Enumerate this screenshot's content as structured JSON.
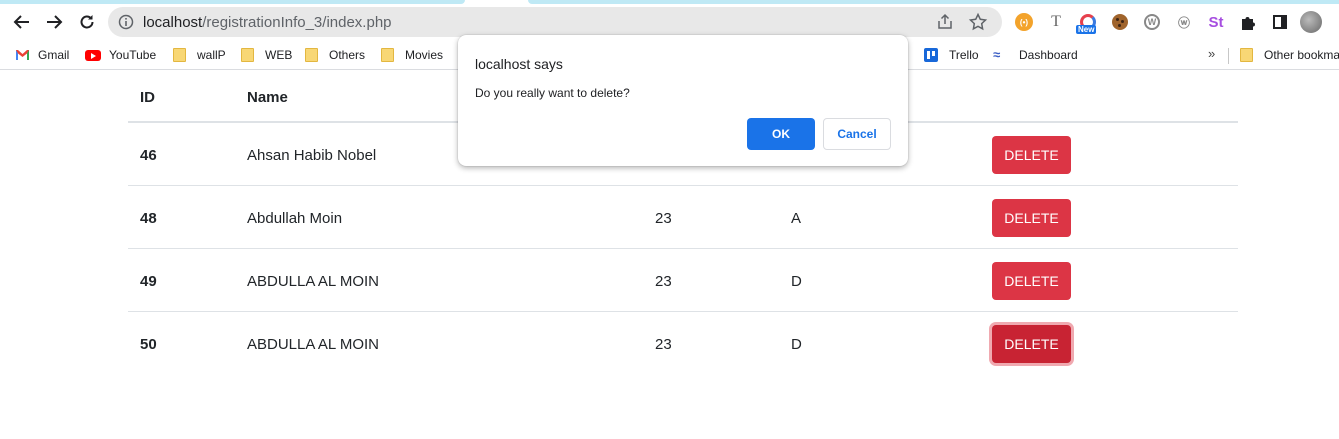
{
  "browser": {
    "url_host": "localhost",
    "url_path": "/registrationInfo_3/index.php",
    "new_badge": "New"
  },
  "bookmarks": [
    {
      "label": "Gmail",
      "icon": "gmail-icon"
    },
    {
      "label": "YouTube",
      "icon": "youtube-icon"
    },
    {
      "label": "wallP",
      "icon": "folder-icon"
    },
    {
      "label": "WEB",
      "icon": "folder-icon"
    },
    {
      "label": "Others",
      "icon": "folder-icon"
    },
    {
      "label": "Movies",
      "icon": "folder-icon"
    },
    {
      "label": "Trello",
      "icon": "trello-icon"
    },
    {
      "label": "Dashboard",
      "icon": "dashboard-icon"
    },
    {
      "label": "Other bookma",
      "icon": "folder-icon"
    }
  ],
  "bookmarks_more": "»",
  "table": {
    "headers": {
      "id": "ID",
      "name": "Name"
    },
    "rows": [
      {
        "id": "46",
        "name": "Ahsan Habib Nobel",
        "age": "",
        "grade": "",
        "action": "DELETE"
      },
      {
        "id": "48",
        "name": "Abdullah Moin",
        "age": "23",
        "grade": "A",
        "action": "DELETE"
      },
      {
        "id": "49",
        "name": "ABDULLA AL MOIN",
        "age": "23",
        "grade": "D",
        "action": "DELETE"
      },
      {
        "id": "50",
        "name": "ABDULLA AL MOIN",
        "age": "23",
        "grade": "D",
        "action": "DELETE"
      }
    ]
  },
  "dialog": {
    "title": "localhost says",
    "message": "Do you really want to delete?",
    "ok_label": "OK",
    "cancel_label": "Cancel"
  },
  "colors": {
    "danger": "#dc3545",
    "primary": "#1a73e8"
  }
}
